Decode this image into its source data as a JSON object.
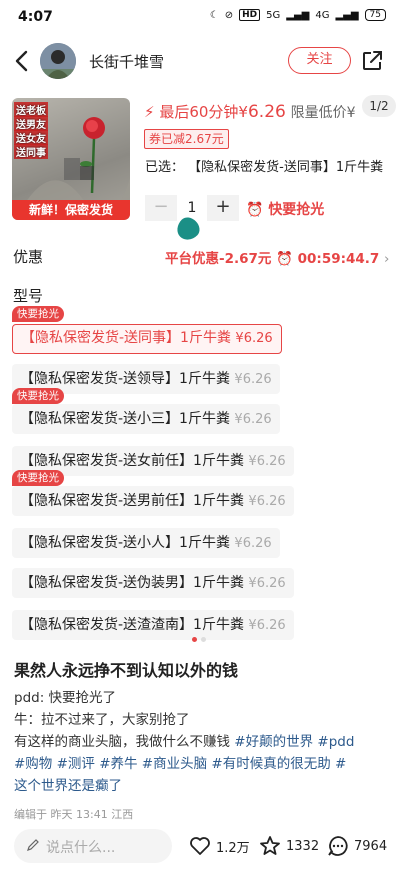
{
  "status_bar": {
    "time": "4:07",
    "network": "5G",
    "network2": "4G",
    "hd": "HD",
    "battery": "75"
  },
  "header": {
    "author_name": "长街千堆雪",
    "follow_label": "关注"
  },
  "product": {
    "image_tags": [
      "送老板",
      "送男友",
      "送女友",
      "送同事"
    ],
    "image_banner": "新鲜！保密发货",
    "price_prefix": "最后60分钟¥",
    "price": "6.26",
    "price_suffix": "限量低价¥",
    "pager": "1/2",
    "coupon": "券已减2.67元",
    "selected_label": "已选：",
    "selected_value": "【隐私保密发货-送同事】1斤牛粪",
    "quantity": "1",
    "minus": "−",
    "plus": "+",
    "hurry_label": "快要抢光"
  },
  "discount": {
    "label": "优惠",
    "info": "平台优惠-2.67元",
    "countdown": "00:59:44.7"
  },
  "model": {
    "title": "型号",
    "badge_text": "快要抢光",
    "options": [
      {
        "name": "【隐私保密发货-送同事】1斤牛粪",
        "price": "¥6.26",
        "active": true,
        "badge": true
      },
      {
        "name": "【隐私保密发货-送领导】1斤牛粪",
        "price": "¥6.26",
        "active": false,
        "badge": false
      },
      {
        "name": "【隐私保密发货-送小三】1斤牛粪",
        "price": "¥6.26",
        "active": false,
        "badge": true
      },
      {
        "name": "【隐私保密发货-送女前任】1斤牛粪",
        "price": "¥6.26",
        "active": false,
        "badge": false
      },
      {
        "name": "【隐私保密发货-送男前任】1斤牛粪",
        "price": "¥6.26",
        "active": false,
        "badge": true
      },
      {
        "name": "【隐私保密发货-送小人】1斤牛粪",
        "price": "¥6.26",
        "active": false,
        "badge": false
      },
      {
        "name": "【隐私保密发货-送伪装男】1斤牛粪",
        "price": "¥6.26",
        "active": false,
        "badge": false
      },
      {
        "name": "【隐私保密发货-送渣渣南】1斤牛粪",
        "price": "¥6.26",
        "active": false,
        "badge": false
      }
    ]
  },
  "post": {
    "title": "果然人永远挣不到认知以外的钱",
    "line1": "pdd: 快要抢光了",
    "line2": "牛：拉不过来了，大家别抢了",
    "line3_text": "有这样的商业头脑，我做什么不赚钱",
    "line3_tags": "#好颠的世界 #pdd",
    "line4_tags": "#购物 #测评 #养牛 #商业头脑 #有时候真的很无助 #",
    "line5_tags": "这个世界还是癫了",
    "meta": "编辑于 昨天 13:41 江西"
  },
  "bottom_bar": {
    "comment_placeholder": "说点什么...",
    "likes": "1.2万",
    "stars": "1332",
    "comments": "7964"
  },
  "colors": {
    "accent": "#e64545",
    "tag_blue": "#2d5a8c"
  }
}
